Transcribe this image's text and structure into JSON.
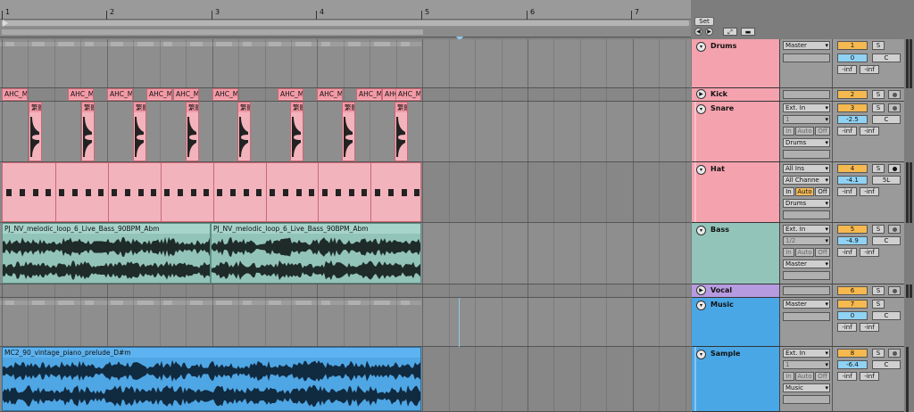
{
  "ruler": {
    "bars": [
      "1",
      "2",
      "3",
      "4",
      "5",
      "6",
      "7"
    ]
  },
  "controls": {
    "set_label": "Set",
    "prev_icon": "arrow-left-icon",
    "next_icon": "arrow-right-icon",
    "expand_icon": "expand-icon",
    "lock_icon": "lock-icon"
  },
  "colors": {
    "drums": "#f4a2ae",
    "bass": "#93c4b9",
    "vocal": "#b79be0",
    "music": "#4aa7e6",
    "track_number": "#f5b94f",
    "volume": "#8fd2f4"
  },
  "clips": {
    "kick": [
      "AHC_M",
      "AHC_M",
      "AHC_M",
      "AHC_M",
      "AHC_M",
      "AHC_M",
      "AHC_M",
      "AHC_M",
      "AHC_M",
      "AHC_M",
      "AHC_M"
    ],
    "snare_label": "繁體",
    "bass": [
      "PJ_NV_melodic_loop_6_Live_Bass_90BPM_Abm",
      "PJ_NV_melodic_loop_6_Live_Bass_90BPM_Abm"
    ],
    "sample": "MC2_90_vintage_piano_prelude_D#m"
  },
  "tracks": [
    {
      "name": "Drums",
      "number": "1",
      "output": "Master",
      "volume": "0",
      "pan": "C",
      "peak_left": "-inf",
      "peak_right": "-inf",
      "solo": "S"
    },
    {
      "name": "Kick",
      "number": "2",
      "solo": "S"
    },
    {
      "name": "Snare",
      "number": "3",
      "input_type": "Ext. In",
      "input_channel": "1",
      "monitor": [
        "In",
        "Auto",
        "Off"
      ],
      "output": "Drums",
      "volume": "-2.5",
      "pan": "C",
      "peak_left": "-inf",
      "peak_right": "-inf",
      "solo": "S"
    },
    {
      "name": "Hat",
      "number": "4",
      "input_type": "All Ins",
      "input_channel": "All Channe",
      "monitor": [
        "In",
        "Auto",
        "Off"
      ],
      "output": "Drums",
      "volume": "-4.1",
      "pan": "5L",
      "peak_left": "-inf",
      "peak_right": "-inf",
      "solo": "S"
    },
    {
      "name": "Bass",
      "number": "5",
      "input_type": "Ext. In",
      "input_channel": "1/2",
      "monitor": [
        "In",
        "Auto",
        "Off"
      ],
      "output": "Master",
      "volume": "-4.9",
      "pan": "C",
      "peak_left": "-inf",
      "peak_right": "-inf",
      "solo": "S"
    },
    {
      "name": "Vocal",
      "number": "6",
      "solo": "S"
    },
    {
      "name": "Music",
      "number": "7",
      "output": "Master",
      "volume": "0",
      "pan": "C",
      "peak_left": "-inf",
      "peak_right": "-inf",
      "solo": "S"
    },
    {
      "name": "Sample",
      "number": "8",
      "input_type": "Ext. In",
      "input_channel": "1",
      "monitor": [
        "In",
        "Auto",
        "Off"
      ],
      "output": "Music",
      "volume": "-6.4",
      "pan": "C",
      "peak_left": "-inf",
      "peak_right": "-inf",
      "solo": "S"
    }
  ]
}
